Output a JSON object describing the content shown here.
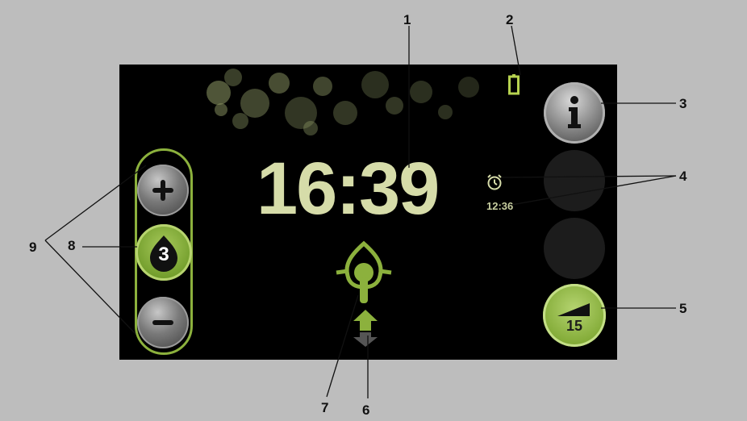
{
  "display": {
    "clock_time": "16:39",
    "alarm_time": "12:36",
    "humidity_level": "3",
    "ramp_value": "15"
  },
  "callouts": {
    "c1": "1",
    "c2": "2",
    "c3": "3",
    "c4": "4",
    "c5": "5",
    "c6": "6",
    "c7": "7",
    "c8": "8",
    "c9": "9"
  },
  "colors": {
    "frame_bg": "#bdbdbd",
    "screen_bg": "#000000",
    "clock_text": "#d6dca9",
    "accent_green": "#8cb13d"
  },
  "icons": {
    "battery": "battery-icon",
    "info": "info-icon",
    "alarm": "alarm-clock-icon",
    "plus": "plus-icon",
    "minus": "minus-icon",
    "humidity": "water-drop-icon",
    "ramp": "ramp-icon",
    "mask": "mask-icon",
    "arrow": "up-down-arrow-icon"
  }
}
